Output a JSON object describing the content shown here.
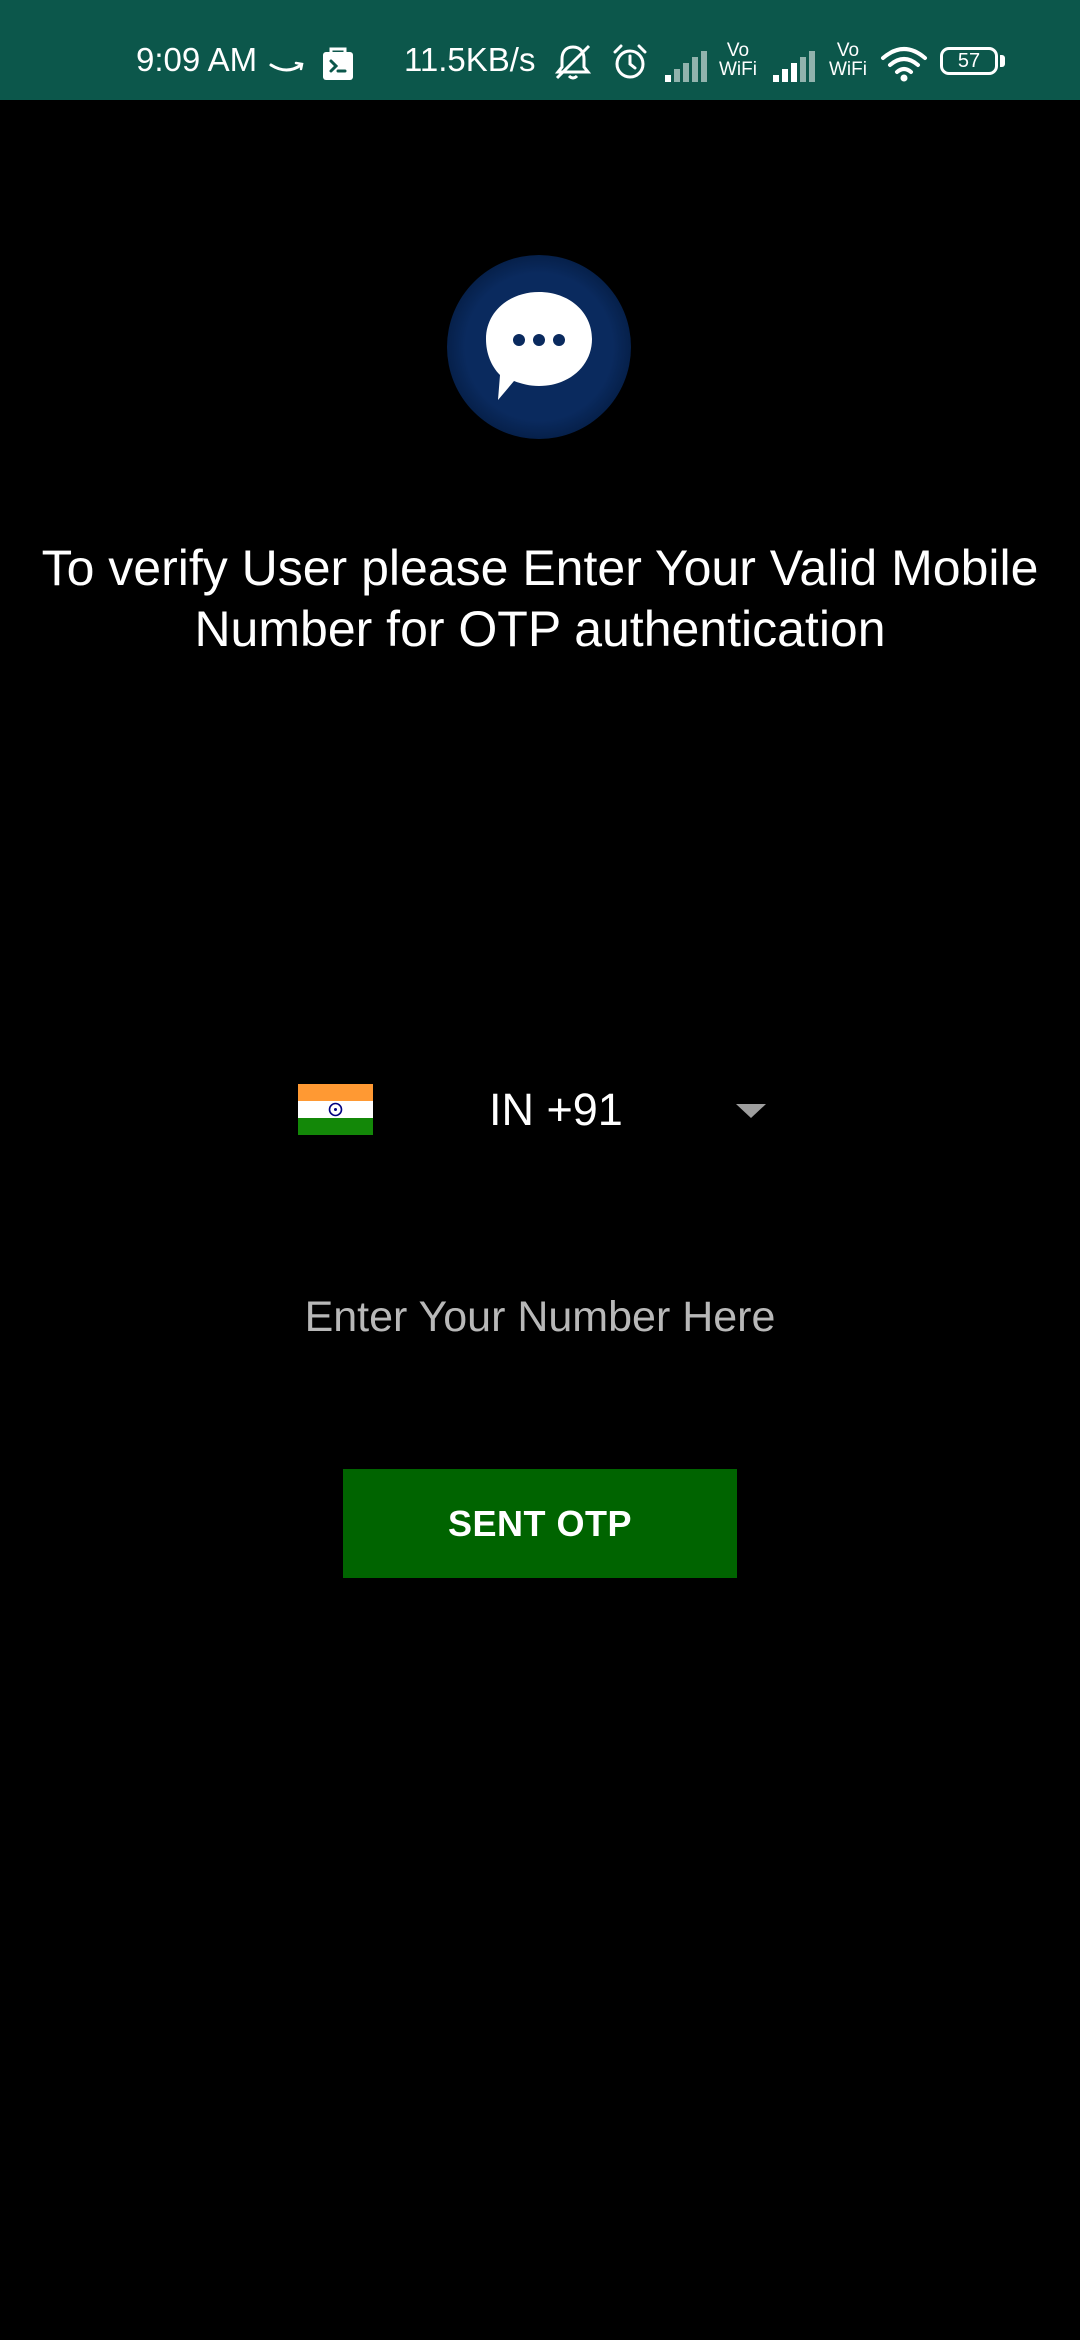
{
  "status_bar": {
    "time": "9:09 AM",
    "network_speed": "11.5KB/s",
    "battery_level": "57",
    "background_color": "#0c574b",
    "icons": [
      "amazon-icon",
      "shopping-bag-icon",
      "mute-icon",
      "alarm-icon",
      "signal-icon",
      "signal-icon",
      "wifi-icon",
      "battery-icon"
    ],
    "sim1_vowifi": {
      "line1": "Vo",
      "line2": "WiFi"
    },
    "sim2_vowifi": {
      "line1": "Vo",
      "line2": "WiFi"
    }
  },
  "logo": {
    "icon": "chat-bubble-icon",
    "circle_color": "#0a2a5e"
  },
  "instruction": {
    "text": "To verify User please Enter Your Valid Mobile Number for OTP authentication"
  },
  "country_picker": {
    "flag_icon": "india-flag-icon",
    "selected_value": "IN  +91",
    "arrow_icon": "dropdown-arrow-icon"
  },
  "phone_input": {
    "placeholder": "Enter Your Number Here",
    "value": ""
  },
  "send_button": {
    "label": "SENT OTP",
    "color": "#006400"
  }
}
